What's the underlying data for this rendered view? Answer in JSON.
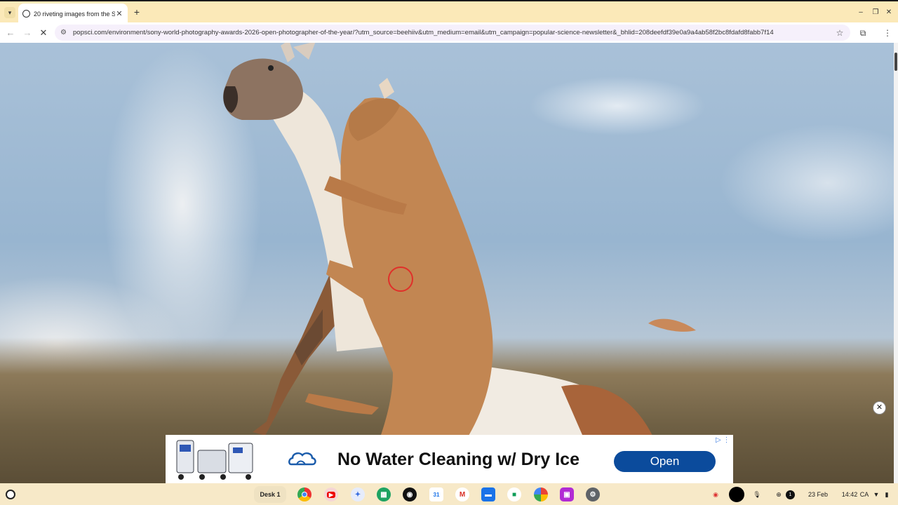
{
  "tab": {
    "title": "20 riveting images from the So"
  },
  "omnibox": {
    "url": "popsci.com/environment/sony-world-photography-awards-2026-open-photographer-of-the-year/?utm_source=beehiiv&utm_medium=email&utm_campaign=popular-science-newsletter&_bhlid=208deefdf39e0a9a4ab58f2bc8fdafd8fabb7f14"
  },
  "icons": {
    "tab_menu": "chevron-down-icon",
    "close_tab": "close-icon",
    "new_tab": "plus-icon",
    "back": "arrow-left-icon",
    "forward": "arrow-right-icon",
    "stop": "close-icon",
    "site_info": "tune-icon",
    "bookmark": "star-icon",
    "extensions": "puzzle-icon",
    "menu": "more-vertical-icon"
  },
  "ad": {
    "headline": "No Water Cleaning w/ Dry Ice",
    "cta": "Open"
  },
  "shelf": {
    "desk_label": "Desk 1",
    "date": "23 Feb",
    "time": "14:42",
    "locale": "CA",
    "badge_count": "1"
  },
  "colors": {
    "tab_strip": "#fbe9b8",
    "shelf": "#f7e9c8",
    "ad_button": "#0b4b9c"
  }
}
